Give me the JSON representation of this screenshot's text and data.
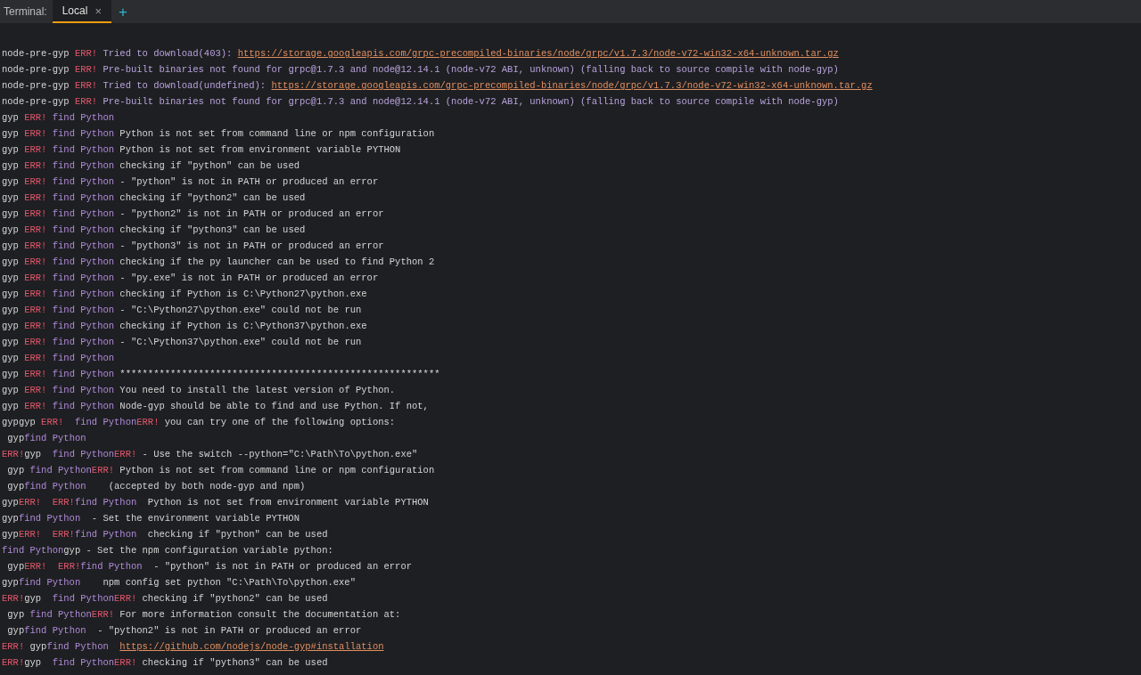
{
  "toolbar": {
    "title": "Terminal:",
    "tabs": [
      {
        "label": "Local",
        "selected": true,
        "close": "×"
      }
    ],
    "add": "+"
  },
  "lines": [
    [
      {
        "kind": "plain",
        "text": "node-pre-gyp "
      },
      {
        "kind": "err",
        "text": "ERR!"
      },
      {
        "kind": "info",
        "text": " Tried to download(403): "
      },
      {
        "kind": "link",
        "text": "https://storage.googleapis.com/grpc-precompiled-binaries/node/grpc/v1.7.3/node-v72-win32-x64-unknown.tar.gz"
      }
    ],
    [
      {
        "kind": "plain",
        "text": "node-pre-gyp "
      },
      {
        "kind": "err",
        "text": "ERR!"
      },
      {
        "kind": "info",
        "text": " Pre-built binaries not found for grpc@1.7.3 and node@12.14.1 (node-v72 ABI, unknown) (falling back to source compile with node-gyp)"
      }
    ],
    [
      {
        "kind": "plain",
        "text": "node-pre-gyp "
      },
      {
        "kind": "err",
        "text": "ERR!"
      },
      {
        "kind": "info",
        "text": " Tried to download(undefined): "
      },
      {
        "kind": "link",
        "text": "https://storage.googleapis.com/grpc-precompiled-binaries/node/grpc/v1.7.3/node-v72-win32-x64-unknown.tar.gz"
      }
    ],
    [
      {
        "kind": "plain",
        "text": "node-pre-gyp "
      },
      {
        "kind": "err",
        "text": "ERR!"
      },
      {
        "kind": "info",
        "text": " Pre-built binaries not found for grpc@1.7.3 and node@12.14.1 (node-v72 ABI, unknown) (falling back to source compile with node-gyp)"
      }
    ],
    [
      {
        "kind": "plain",
        "text": "gyp "
      },
      {
        "kind": "err",
        "text": "ERR! "
      },
      {
        "kind": "find",
        "text": "find Python"
      }
    ],
    [
      {
        "kind": "plain",
        "text": "gyp "
      },
      {
        "kind": "err",
        "text": "ERR! "
      },
      {
        "kind": "find",
        "text": "find Python"
      },
      {
        "kind": "plain",
        "text": " Python is not set from command line or npm configuration"
      }
    ],
    [
      {
        "kind": "plain",
        "text": "gyp "
      },
      {
        "kind": "err",
        "text": "ERR! "
      },
      {
        "kind": "find",
        "text": "find Python"
      },
      {
        "kind": "plain",
        "text": " Python is not set from environment variable PYTHON"
      }
    ],
    [
      {
        "kind": "plain",
        "text": "gyp "
      },
      {
        "kind": "err",
        "text": "ERR! "
      },
      {
        "kind": "find",
        "text": "find Python"
      },
      {
        "kind": "plain",
        "text": " checking if \"python\" can be used"
      }
    ],
    [
      {
        "kind": "plain",
        "text": "gyp "
      },
      {
        "kind": "err",
        "text": "ERR! "
      },
      {
        "kind": "find",
        "text": "find Python"
      },
      {
        "kind": "plain",
        "text": " - \"python\" is not in PATH or produced an error"
      }
    ],
    [
      {
        "kind": "plain",
        "text": "gyp "
      },
      {
        "kind": "err",
        "text": "ERR! "
      },
      {
        "kind": "find",
        "text": "find Python"
      },
      {
        "kind": "plain",
        "text": " checking if \"python2\" can be used"
      }
    ],
    [
      {
        "kind": "plain",
        "text": "gyp "
      },
      {
        "kind": "err",
        "text": "ERR! "
      },
      {
        "kind": "find",
        "text": "find Python"
      },
      {
        "kind": "plain",
        "text": " - \"python2\" is not in PATH or produced an error"
      }
    ],
    [
      {
        "kind": "plain",
        "text": "gyp "
      },
      {
        "kind": "err",
        "text": "ERR! "
      },
      {
        "kind": "find",
        "text": "find Python"
      },
      {
        "kind": "plain",
        "text": " checking if \"python3\" can be used"
      }
    ],
    [
      {
        "kind": "plain",
        "text": "gyp "
      },
      {
        "kind": "err",
        "text": "ERR! "
      },
      {
        "kind": "find",
        "text": "find Python"
      },
      {
        "kind": "plain",
        "text": " - \"python3\" is not in PATH or produced an error"
      }
    ],
    [
      {
        "kind": "plain",
        "text": "gyp "
      },
      {
        "kind": "err",
        "text": "ERR! "
      },
      {
        "kind": "find",
        "text": "find Python"
      },
      {
        "kind": "plain",
        "text": " checking if the py launcher can be used to find Python 2"
      }
    ],
    [
      {
        "kind": "plain",
        "text": "gyp "
      },
      {
        "kind": "err",
        "text": "ERR! "
      },
      {
        "kind": "find",
        "text": "find Python"
      },
      {
        "kind": "plain",
        "text": " - \"py.exe\" is not in PATH or produced an error"
      }
    ],
    [
      {
        "kind": "plain",
        "text": "gyp "
      },
      {
        "kind": "err",
        "text": "ERR! "
      },
      {
        "kind": "find",
        "text": "find Python"
      },
      {
        "kind": "plain",
        "text": " checking if Python is C:\\Python27\\python.exe"
      }
    ],
    [
      {
        "kind": "plain",
        "text": "gyp "
      },
      {
        "kind": "err",
        "text": "ERR! "
      },
      {
        "kind": "find",
        "text": "find Python"
      },
      {
        "kind": "plain",
        "text": " - \"C:\\Python27\\python.exe\" could not be run"
      }
    ],
    [
      {
        "kind": "plain",
        "text": "gyp "
      },
      {
        "kind": "err",
        "text": "ERR! "
      },
      {
        "kind": "find",
        "text": "find Python"
      },
      {
        "kind": "plain",
        "text": " checking if Python is C:\\Python37\\python.exe"
      }
    ],
    [
      {
        "kind": "plain",
        "text": "gyp "
      },
      {
        "kind": "err",
        "text": "ERR! "
      },
      {
        "kind": "find",
        "text": "find Python"
      },
      {
        "kind": "plain",
        "text": " - \"C:\\Python37\\python.exe\" could not be run"
      }
    ],
    [
      {
        "kind": "plain",
        "text": "gyp "
      },
      {
        "kind": "err",
        "text": "ERR! "
      },
      {
        "kind": "find",
        "text": "find Python"
      }
    ],
    [
      {
        "kind": "plain",
        "text": "gyp "
      },
      {
        "kind": "err",
        "text": "ERR! "
      },
      {
        "kind": "find",
        "text": "find Python"
      },
      {
        "kind": "plain",
        "text": " *********************************************************"
      }
    ],
    [
      {
        "kind": "plain",
        "text": "gyp "
      },
      {
        "kind": "err",
        "text": "ERR! "
      },
      {
        "kind": "find",
        "text": "find Python"
      },
      {
        "kind": "plain",
        "text": " You need to install the latest version of Python."
      }
    ],
    [
      {
        "kind": "plain",
        "text": "gyp "
      },
      {
        "kind": "err",
        "text": "ERR! "
      },
      {
        "kind": "find",
        "text": "find Python"
      },
      {
        "kind": "plain",
        "text": " Node-gyp should be able to find and use Python. If not,"
      }
    ],
    [
      {
        "kind": "plain",
        "text": "gypgyp "
      },
      {
        "kind": "err",
        "text": "ERR!  "
      },
      {
        "kind": "find",
        "text": "find Python"
      },
      {
        "kind": "err",
        "text": "ERR!"
      },
      {
        "kind": "plain",
        "text": " you can try one of the following options:"
      }
    ],
    [
      {
        "kind": "plain",
        "text": " gyp"
      },
      {
        "kind": "find",
        "text": "find Python"
      }
    ],
    [
      {
        "kind": "err",
        "text": "ERR!"
      },
      {
        "kind": "plain",
        "text": "gyp  "
      },
      {
        "kind": "find",
        "text": "find Python"
      },
      {
        "kind": "err",
        "text": "ERR!"
      },
      {
        "kind": "plain",
        "text": " - Use the switch --python=\"C:\\Path\\To\\python.exe\""
      }
    ],
    [
      {
        "kind": "plain",
        "text": " gyp "
      },
      {
        "kind": "find",
        "text": "find Python"
      },
      {
        "kind": "err",
        "text": "ERR!"
      },
      {
        "kind": "plain",
        "text": " Python is not set from command line or npm configuration"
      }
    ],
    [
      {
        "kind": "plain",
        "text": " gyp"
      },
      {
        "kind": "find",
        "text": "find Python"
      },
      {
        "kind": "plain",
        "text": "    (accepted by both node-gyp and npm)"
      }
    ],
    [
      {
        "kind": "plain",
        "text": "gyp"
      },
      {
        "kind": "err",
        "text": "ERR!  "
      },
      {
        "kind": "err",
        "text": "ERR!"
      },
      {
        "kind": "find",
        "text": "find Python"
      },
      {
        "kind": "plain",
        "text": "  Python is not set from environment variable PYTHON"
      }
    ],
    [
      {
        "kind": "plain",
        "text": "gyp"
      },
      {
        "kind": "find",
        "text": "find Python"
      },
      {
        "kind": "plain",
        "text": "  - Set the environment variable PYTHON"
      }
    ],
    [
      {
        "kind": "plain",
        "text": "gyp"
      },
      {
        "kind": "err",
        "text": "ERR!  "
      },
      {
        "kind": "err",
        "text": "ERR!"
      },
      {
        "kind": "find",
        "text": "find Python"
      },
      {
        "kind": "plain",
        "text": "  checking if \"python\" can be used"
      }
    ],
    [
      {
        "kind": "find",
        "text": "find Python"
      },
      {
        "kind": "plain",
        "text": "gyp - Set the npm configuration variable python:"
      }
    ],
    [
      {
        "kind": "plain",
        "text": " gyp"
      },
      {
        "kind": "err",
        "text": "ERR!  "
      },
      {
        "kind": "err",
        "text": "ERR!"
      },
      {
        "kind": "find",
        "text": "find Python"
      },
      {
        "kind": "plain",
        "text": "  - \"python\" is not in PATH or produced an error"
      }
    ],
    [
      {
        "kind": "plain",
        "text": "gyp"
      },
      {
        "kind": "find",
        "text": "find Python"
      },
      {
        "kind": "plain",
        "text": "    npm config set python \"C:\\Path\\To\\python.exe\""
      }
    ],
    [
      {
        "kind": "err",
        "text": "ERR!"
      },
      {
        "kind": "plain",
        "text": "gyp  "
      },
      {
        "kind": "find",
        "text": "find Python"
      },
      {
        "kind": "err",
        "text": "ERR!"
      },
      {
        "kind": "plain",
        "text": " checking if \"python2\" can be used"
      }
    ],
    [
      {
        "kind": "plain",
        "text": " gyp "
      },
      {
        "kind": "find",
        "text": "find Python"
      },
      {
        "kind": "err",
        "text": "ERR!"
      },
      {
        "kind": "plain",
        "text": " For more information consult the documentation at:"
      }
    ],
    [
      {
        "kind": "plain",
        "text": " gyp"
      },
      {
        "kind": "find",
        "text": "find Python"
      },
      {
        "kind": "plain",
        "text": "  - \"python2\" is not in PATH or produced an error"
      }
    ],
    [
      {
        "kind": "err",
        "text": "ERR!"
      },
      {
        "kind": "plain",
        "text": " gyp"
      },
      {
        "kind": "find",
        "text": "find Python  "
      },
      {
        "kind": "link",
        "text": "https://github.com/nodejs/node-gyp#installation"
      }
    ],
    [
      {
        "kind": "err",
        "text": "ERR!"
      },
      {
        "kind": "plain",
        "text": "gyp  "
      },
      {
        "kind": "find",
        "text": "find Python"
      },
      {
        "kind": "err",
        "text": "ERR!"
      },
      {
        "kind": "plain",
        "text": " checking if \"python3\" can be used"
      }
    ]
  ]
}
